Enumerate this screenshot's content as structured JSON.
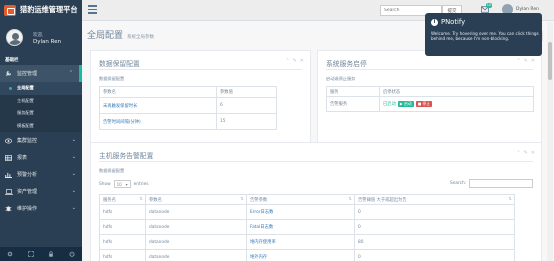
{
  "sidebar": {
    "brand": "猎豹运维管理平台",
    "welcome": "欢迎,",
    "username": "Dylan Ren",
    "section": "基础栏",
    "menu": [
      {
        "label": "监控管理",
        "submenu": [
          "全局配置",
          "主机配置",
          "服务配置",
          "模板配置"
        ],
        "current": "全局配置"
      },
      {
        "label": "集群监控"
      },
      {
        "label": "报表"
      },
      {
        "label": "预警分析"
      },
      {
        "label": "资产管理"
      },
      {
        "label": "维护操作"
      }
    ]
  },
  "topnav": {
    "search_placeholder": "Search",
    "search_button": "提交",
    "badge": "10",
    "user": "Dylan Ren"
  },
  "page": {
    "title": "全局配置",
    "subtitle": "系统全局参数"
  },
  "panel_data": {
    "title": "数据保留配置",
    "desc": "数据保留配置",
    "columns": [
      "参数名",
      "参数值"
    ],
    "rows": [
      {
        "name": "未再触发保留时长",
        "value": "6"
      },
      {
        "name": "告警时间间隔(分钟)",
        "value": "15"
      }
    ]
  },
  "panel_service": {
    "title": "系统服务启停",
    "desc": "启动或停止服务",
    "columns": [
      "服务",
      "启停状态"
    ],
    "row": {
      "name": "告警服务",
      "status": "已启动",
      "start": "▶ 启动",
      "stop": "■ 停止"
    }
  },
  "panel_alarm": {
    "title": "主机服务告警配置",
    "desc": "数据保留配置",
    "show": "Show",
    "entries_value": "10",
    "entries": "entries",
    "search_label": "Search:",
    "columns": [
      "服务名",
      "参数名",
      "告警参数",
      "告警阈值 大于或超出为告"
    ],
    "rows": [
      {
        "c1": "hdfs",
        "c2": "datanode",
        "c3": "Error日志数",
        "c4": "0"
      },
      {
        "c1": "hdfs",
        "c2": "datanode",
        "c3": "Fatal日志数",
        "c4": "0"
      },
      {
        "c1": "hdfs",
        "c2": "datanode",
        "c3": "堆内存使用率",
        "c4": "80"
      },
      {
        "c1": "hdfs",
        "c2": "datanode",
        "c3": "堆外内存",
        "c4": "0"
      }
    ]
  },
  "notice": {
    "title": "PNotify",
    "text": "Welcome. Try hovering over me. You can click things behind me, because I'm non-blocking."
  },
  "colors": {
    "sidebar": "#2a3f54",
    "accent": "#1abb9c",
    "success": "#26b99a",
    "danger": "#d9534f"
  }
}
